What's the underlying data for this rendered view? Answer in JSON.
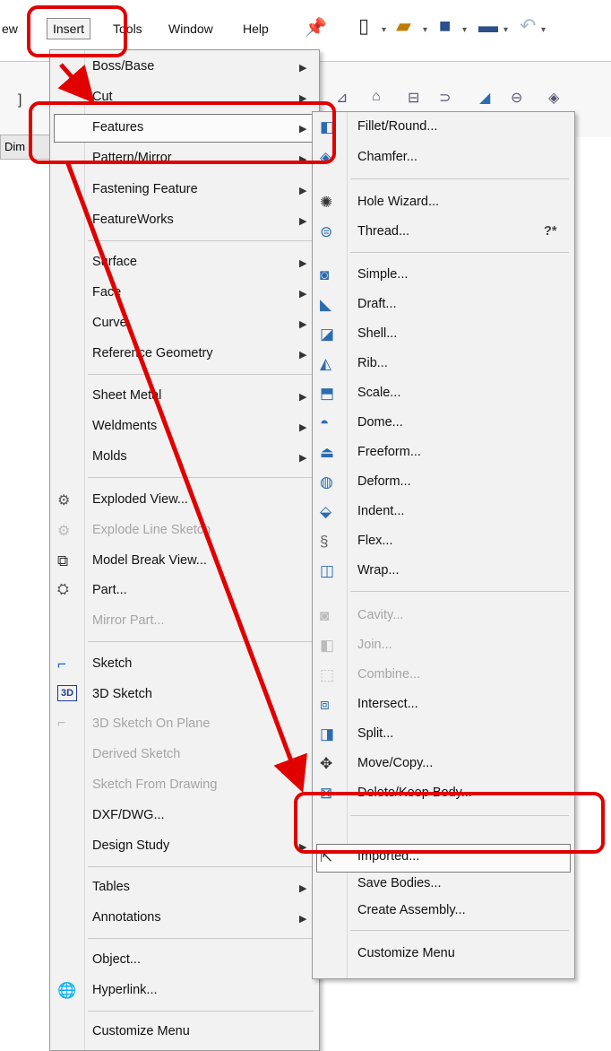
{
  "menubar": {
    "items": [
      "ew",
      "Insert",
      "Tools",
      "Window",
      "Help"
    ]
  },
  "dim_tab": "Dim",
  "main_menu": {
    "items": [
      {
        "label": "Boss/Base",
        "arrow": true
      },
      {
        "label": "Cut",
        "arrow": true
      },
      {
        "label": "Features",
        "arrow": true
      },
      {
        "label": "Pattern/Mirror",
        "arrow": true
      },
      {
        "label": "Fastening Feature",
        "arrow": true
      },
      {
        "label": "FeatureWorks",
        "arrow": true
      },
      {
        "label": "Surface",
        "arrow": true
      },
      {
        "label": "Face",
        "arrow": true
      },
      {
        "label": "Curve",
        "arrow": true
      },
      {
        "label": "Reference Geometry",
        "arrow": true
      },
      {
        "label": "Sheet Metal",
        "arrow": true
      },
      {
        "label": "Weldments",
        "arrow": true
      },
      {
        "label": "Molds",
        "arrow": true
      },
      {
        "label": "Exploded View...",
        "icon": "exploded-view-icon"
      },
      {
        "label": "Explode Line Sketch",
        "disabled": true,
        "icon": "explode-line-sketch-icon"
      },
      {
        "label": "Model Break View...",
        "icon": "model-break-view-icon"
      },
      {
        "label": "Part...",
        "icon": "part-icon"
      },
      {
        "label": "Mirror Part...",
        "disabled": true
      },
      {
        "label": "Sketch",
        "icon": "sketch-icon"
      },
      {
        "label": "3D Sketch",
        "icon": "3d-sketch-icon"
      },
      {
        "label": "3D Sketch On Plane",
        "disabled": true,
        "icon": "3d-sketch-on-plane-icon"
      },
      {
        "label": "Derived Sketch",
        "disabled": true
      },
      {
        "label": "Sketch From Drawing",
        "disabled": true
      },
      {
        "label": "DXF/DWG..."
      },
      {
        "label": "Design Study",
        "arrow": true
      },
      {
        "label": "Tables",
        "arrow": true
      },
      {
        "label": "Annotations",
        "arrow": true
      },
      {
        "label": "Object..."
      },
      {
        "label": "Hyperlink...",
        "icon": "hyperlink-icon"
      },
      {
        "label": "Customize Menu"
      }
    ]
  },
  "features_submenu": {
    "items": [
      {
        "label": "Fillet/Round...",
        "icon": "fillet-icon"
      },
      {
        "label": "Chamfer...",
        "icon": "chamfer-icon"
      },
      {
        "label": "Hole Wizard...",
        "icon": "hole-wizard-icon"
      },
      {
        "label": "Thread...",
        "icon": "thread-icon",
        "badge": "?*"
      },
      {
        "label": "Simple...",
        "icon": "simple-hole-icon"
      },
      {
        "label": "Draft...",
        "icon": "draft-icon"
      },
      {
        "label": "Shell...",
        "icon": "shell-icon"
      },
      {
        "label": "Rib...",
        "icon": "rib-icon"
      },
      {
        "label": "Scale...",
        "icon": "scale-icon"
      },
      {
        "label": "Dome...",
        "icon": "dome-icon"
      },
      {
        "label": "Freeform...",
        "icon": "freeform-icon"
      },
      {
        "label": "Deform...",
        "icon": "deform-icon"
      },
      {
        "label": "Indent...",
        "icon": "indent-icon"
      },
      {
        "label": "Flex...",
        "icon": "flex-icon"
      },
      {
        "label": "Wrap...",
        "icon": "wrap-icon"
      },
      {
        "label": "Cavity...",
        "icon": "cavity-icon",
        "disabled": true
      },
      {
        "label": "Join...",
        "icon": "join-icon",
        "disabled": true
      },
      {
        "label": "Combine...",
        "icon": "combine-icon",
        "disabled": true
      },
      {
        "label": "Intersect...",
        "icon": "intersect-icon"
      },
      {
        "label": "Split...",
        "icon": "split-icon"
      },
      {
        "label": "Move/Copy...",
        "icon": "move-copy-icon"
      },
      {
        "label": "Delete/Keep Body...",
        "icon": "delete-keep-body-icon"
      },
      {
        "label": "Imported...",
        "icon": "imported-icon"
      },
      {
        "label": "Save Bodies..."
      },
      {
        "label": "Create Assembly..."
      },
      {
        "label": "Customize Menu"
      }
    ]
  },
  "colors": {
    "callout": "#e10000",
    "menu_bg": "#f2f2f2",
    "disabled": "#a5a5a5"
  }
}
